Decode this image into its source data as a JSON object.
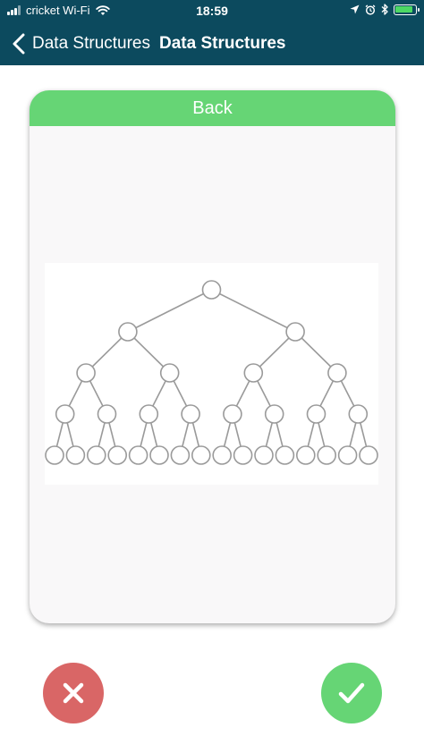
{
  "status_bar": {
    "carrier": "cricket Wi-Fi",
    "time": "18:59",
    "battery_level": 0.95
  },
  "nav": {
    "back_label": "Data Structures",
    "title": "Data Structures"
  },
  "card": {
    "header_label": "Back",
    "image": {
      "icon": "binary-tree-diagram",
      "levels": 5
    }
  },
  "actions": {
    "reject_icon": "close-icon",
    "accept_icon": "checkmark-icon"
  },
  "colors": {
    "topbar": "#0c4a5e",
    "card_header": "#66d575",
    "reject": "#d96666",
    "accept": "#66d575",
    "battery": "#4cd964",
    "tree_stroke": "#9a9a9a"
  }
}
